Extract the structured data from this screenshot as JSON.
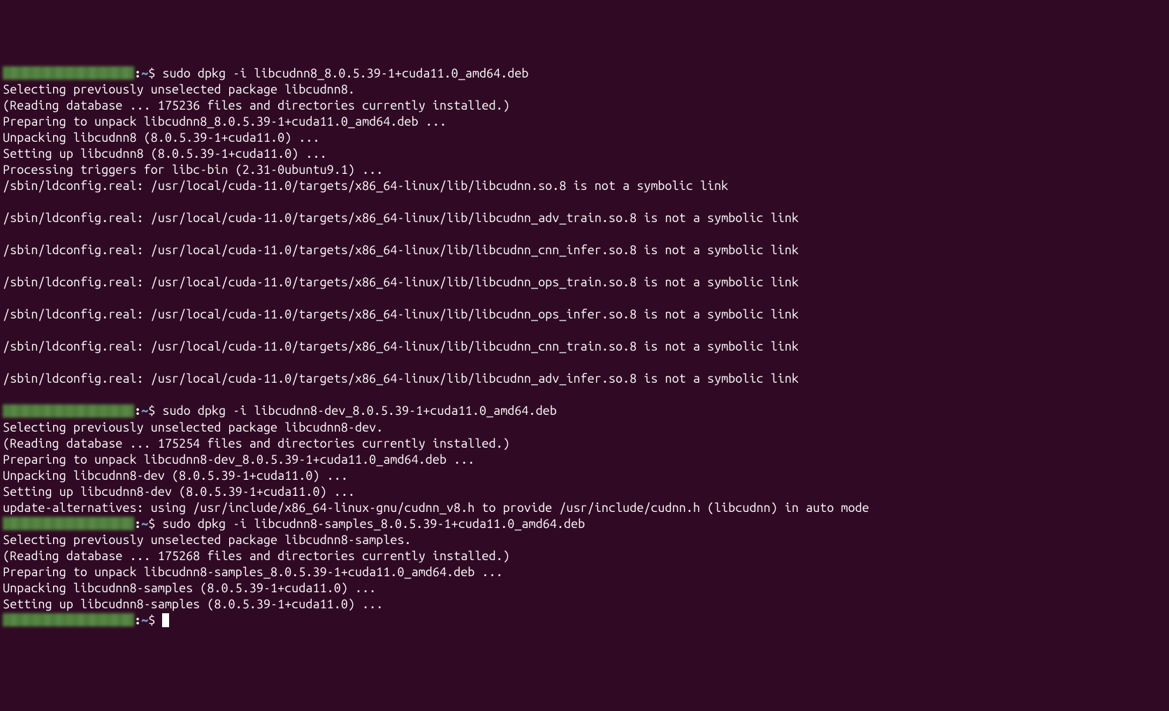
{
  "blocks": [
    {
      "prompt": {
        "host_hidden": true,
        "colon": ":",
        "path": "~",
        "dollar": "$ "
      },
      "command": "sudo dpkg -i libcudnn8_8.0.5.39-1+cuda11.0_amd64.deb",
      "output": [
        "Selecting previously unselected package libcudnn8.",
        "(Reading database ... 175236 files and directories currently installed.)",
        "Preparing to unpack libcudnn8_8.0.5.39-1+cuda11.0_amd64.deb ...",
        "Unpacking libcudnn8 (8.0.5.39-1+cuda11.0) ...",
        "Setting up libcudnn8 (8.0.5.39-1+cuda11.0) ...",
        "Processing triggers for libc-bin (2.31-0ubuntu9.1) ...",
        "/sbin/ldconfig.real: /usr/local/cuda-11.0/targets/x86_64-linux/lib/libcudnn.so.8 is not a symbolic link",
        "",
        "/sbin/ldconfig.real: /usr/local/cuda-11.0/targets/x86_64-linux/lib/libcudnn_adv_train.so.8 is not a symbolic link",
        "",
        "/sbin/ldconfig.real: /usr/local/cuda-11.0/targets/x86_64-linux/lib/libcudnn_cnn_infer.so.8 is not a symbolic link",
        "",
        "/sbin/ldconfig.real: /usr/local/cuda-11.0/targets/x86_64-linux/lib/libcudnn_ops_train.so.8 is not a symbolic link",
        "",
        "/sbin/ldconfig.real: /usr/local/cuda-11.0/targets/x86_64-linux/lib/libcudnn_ops_infer.so.8 is not a symbolic link",
        "",
        "/sbin/ldconfig.real: /usr/local/cuda-11.0/targets/x86_64-linux/lib/libcudnn_cnn_train.so.8 is not a symbolic link",
        "",
        "/sbin/ldconfig.real: /usr/local/cuda-11.0/targets/x86_64-linux/lib/libcudnn_adv_infer.so.8 is not a symbolic link",
        ""
      ]
    },
    {
      "prompt": {
        "host_hidden": true,
        "colon": ":",
        "path": "~",
        "dollar": "$ "
      },
      "command": "sudo dpkg -i libcudnn8-dev_8.0.5.39-1+cuda11.0_amd64.deb",
      "output": [
        "Selecting previously unselected package libcudnn8-dev.",
        "(Reading database ... 175254 files and directories currently installed.)",
        "Preparing to unpack libcudnn8-dev_8.0.5.39-1+cuda11.0_amd64.deb ...",
        "Unpacking libcudnn8-dev (8.0.5.39-1+cuda11.0) ...",
        "Setting up libcudnn8-dev (8.0.5.39-1+cuda11.0) ...",
        "update-alternatives: using /usr/include/x86_64-linux-gnu/cudnn_v8.h to provide /usr/include/cudnn.h (libcudnn) in auto mode"
      ]
    },
    {
      "prompt": {
        "host_hidden": true,
        "colon": ":",
        "path": "~",
        "dollar": "$ "
      },
      "command": "sudo dpkg -i libcudnn8-samples_8.0.5.39-1+cuda11.0_amd64.deb",
      "output": [
        "Selecting previously unselected package libcudnn8-samples.",
        "(Reading database ... 175268 files and directories currently installed.)",
        "Preparing to unpack libcudnn8-samples_8.0.5.39-1+cuda11.0_amd64.deb ...",
        "Unpacking libcudnn8-samples (8.0.5.39-1+cuda11.0) ...",
        "Setting up libcudnn8-samples (8.0.5.39-1+cuda11.0) ..."
      ]
    },
    {
      "prompt": {
        "host_hidden": true,
        "colon": ":",
        "path": "~",
        "dollar": "$ "
      },
      "command": "",
      "cursor": true,
      "output": []
    }
  ]
}
